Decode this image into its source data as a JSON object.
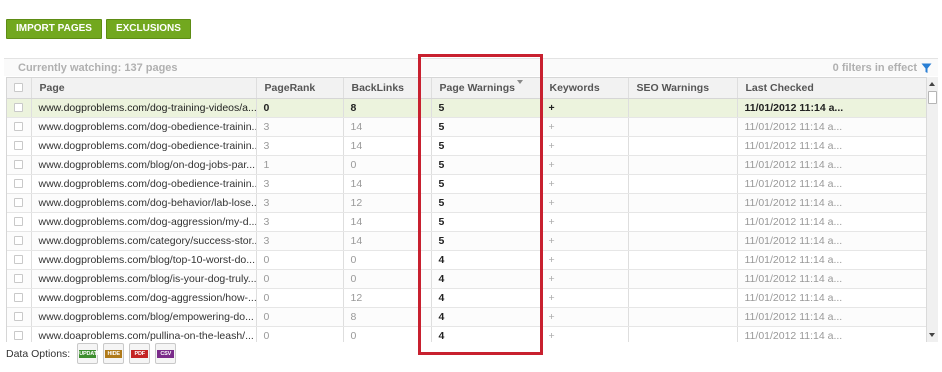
{
  "toolbar": {
    "import_label": "IMPORT PAGES",
    "exclusions_label": "EXCLUSIONS"
  },
  "watch": {
    "text": "Currently watching: 137 pages",
    "filters_text": "0 filters in effect"
  },
  "columns": {
    "page": "Page",
    "pagerank": "PageRank",
    "backlinks": "BackLinks",
    "page_warnings": "Page Warnings",
    "keywords": "Keywords",
    "seo_warnings": "SEO Warnings",
    "last_checked": "Last Checked"
  },
  "rows": [
    {
      "page": "www.dogproblems.com/dog-training-videos/a...",
      "pagerank": "0",
      "backlinks": "8",
      "page_warnings": "5",
      "keywords": "+",
      "seo_warnings": "",
      "last_checked": "11/01/2012 11:14 a...",
      "selected": true
    },
    {
      "page": "www.dogproblems.com/dog-obedience-trainin...",
      "pagerank": "3",
      "backlinks": "14",
      "page_warnings": "5",
      "keywords": "+",
      "seo_warnings": "",
      "last_checked": "11/01/2012 11:14 a..."
    },
    {
      "page": "www.dogproblems.com/dog-obedience-trainin...",
      "pagerank": "3",
      "backlinks": "14",
      "page_warnings": "5",
      "keywords": "+",
      "seo_warnings": "",
      "last_checked": "11/01/2012 11:14 a..."
    },
    {
      "page": "www.dogproblems.com/blog/on-dog-jobs-par...",
      "pagerank": "1",
      "backlinks": "0",
      "page_warnings": "5",
      "keywords": "+",
      "seo_warnings": "",
      "last_checked": "11/01/2012 11:14 a..."
    },
    {
      "page": "www.dogproblems.com/dog-obedience-trainin...",
      "pagerank": "3",
      "backlinks": "14",
      "page_warnings": "5",
      "keywords": "+",
      "seo_warnings": "",
      "last_checked": "11/01/2012 11:14 a..."
    },
    {
      "page": "www.dogproblems.com/dog-behavior/lab-lose...",
      "pagerank": "3",
      "backlinks": "12",
      "page_warnings": "5",
      "keywords": "+",
      "seo_warnings": "",
      "last_checked": "11/01/2012 11:14 a..."
    },
    {
      "page": "www.dogproblems.com/dog-aggression/my-d...",
      "pagerank": "3",
      "backlinks": "14",
      "page_warnings": "5",
      "keywords": "+",
      "seo_warnings": "",
      "last_checked": "11/01/2012 11:14 a..."
    },
    {
      "page": "www.dogproblems.com/category/success-stor...",
      "pagerank": "3",
      "backlinks": "14",
      "page_warnings": "5",
      "keywords": "+",
      "seo_warnings": "",
      "last_checked": "11/01/2012 11:14 a..."
    },
    {
      "page": "www.dogproblems.com/blog/top-10-worst-do...",
      "pagerank": "0",
      "backlinks": "0",
      "page_warnings": "4",
      "keywords": "+",
      "seo_warnings": "",
      "last_checked": "11/01/2012 11:14 a..."
    },
    {
      "page": "www.dogproblems.com/blog/is-your-dog-truly...",
      "pagerank": "0",
      "backlinks": "0",
      "page_warnings": "4",
      "keywords": "+",
      "seo_warnings": "",
      "last_checked": "11/01/2012 11:14 a..."
    },
    {
      "page": "www.dogproblems.com/dog-aggression/how-...",
      "pagerank": "0",
      "backlinks": "12",
      "page_warnings": "4",
      "keywords": "+",
      "seo_warnings": "",
      "last_checked": "11/01/2012 11:14 a..."
    },
    {
      "page": "www.dogproblems.com/blog/empowering-do...",
      "pagerank": "0",
      "backlinks": "8",
      "page_warnings": "4",
      "keywords": "+",
      "seo_warnings": "",
      "last_checked": "11/01/2012 11:14 a..."
    },
    {
      "page": "www.doaproblems.com/pullina-on-the-leash/...",
      "pagerank": "0",
      "backlinks": "0",
      "page_warnings": "4",
      "keywords": "+",
      "seo_warnings": "",
      "last_checked": "11/01/2012 11:14 a..."
    }
  ],
  "data_options": {
    "label": "Data Options:",
    "update": "UPDATE",
    "hide": "HIDE",
    "pdf": "PDF",
    "csv": "CSV"
  },
  "colors": {
    "button_green": "#72a81f",
    "selected_row": "#ecf3dd",
    "highlight_red": "#c8202f",
    "filter_icon_blue": "#2a7fd4"
  }
}
